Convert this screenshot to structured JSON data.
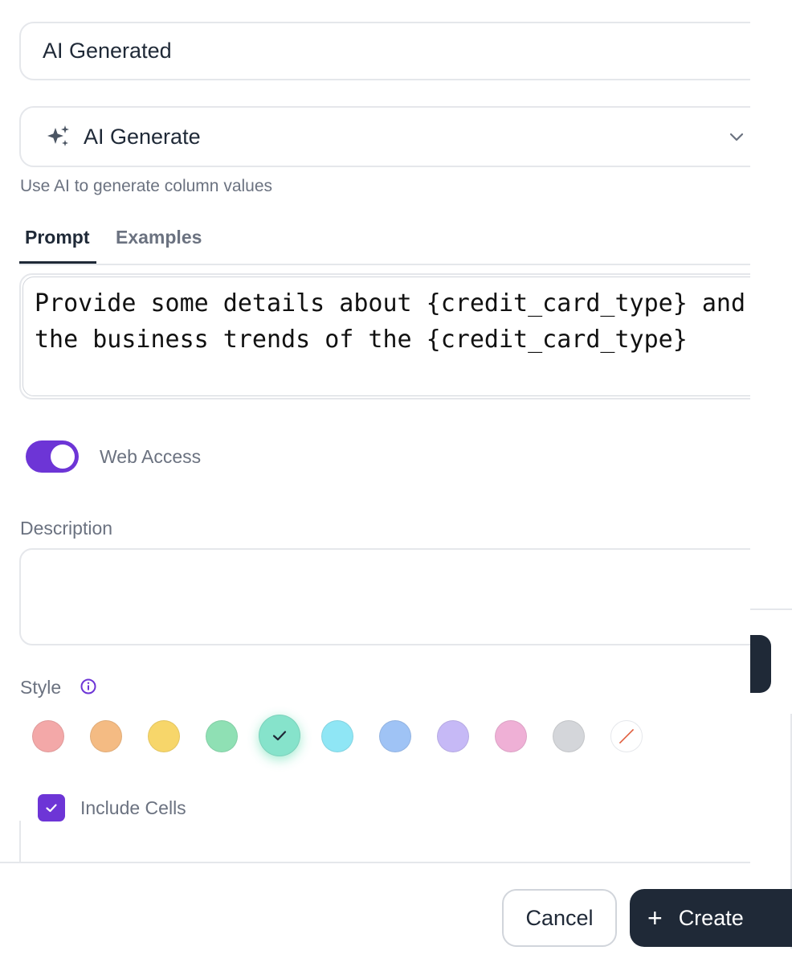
{
  "column_name": {
    "value": "AI Generated"
  },
  "column_type": {
    "icon": "sparkles-icon",
    "label": "AI Generate",
    "chevron": "chevron-down-icon"
  },
  "helper_text": "Use AI to generate column values",
  "tabs": [
    {
      "label": "Prompt",
      "active": true
    },
    {
      "label": "Examples",
      "active": false
    }
  ],
  "prompt": {
    "text": "Provide some details about {credit_card_type} and the business trends of the {credit_card_type}"
  },
  "web_access": {
    "label": "Web Access",
    "enabled": true
  },
  "description": {
    "label": "Description",
    "value": ""
  },
  "style": {
    "label": "Style",
    "info_icon": "info-icon",
    "selected_index": 4,
    "swatches": [
      {
        "name": "red",
        "color": "#f3a8a8"
      },
      {
        "name": "orange",
        "color": "#f4bb83"
      },
      {
        "name": "yellow",
        "color": "#f7d66a"
      },
      {
        "name": "green",
        "color": "#8fe0b4"
      },
      {
        "name": "teal",
        "color": "#86e3cb"
      },
      {
        "name": "cyan",
        "color": "#8fe6f5"
      },
      {
        "name": "blue",
        "color": "#9fc3f5"
      },
      {
        "name": "purple",
        "color": "#c6b9f6"
      },
      {
        "name": "pink",
        "color": "#efb0d6"
      },
      {
        "name": "gray",
        "color": "#d4d6da"
      },
      {
        "name": "none",
        "color": "#ffffff"
      }
    ]
  },
  "include_cells": {
    "label": "Include Cells",
    "checked": true
  },
  "footer": {
    "cancel_label": "Cancel",
    "create_label": "Create",
    "create_icon": "plus-icon"
  },
  "colors": {
    "accent": "#6d35d6",
    "primary_button": "#1f2937",
    "border": "#e5e7eb",
    "muted_text": "#6b7280"
  }
}
